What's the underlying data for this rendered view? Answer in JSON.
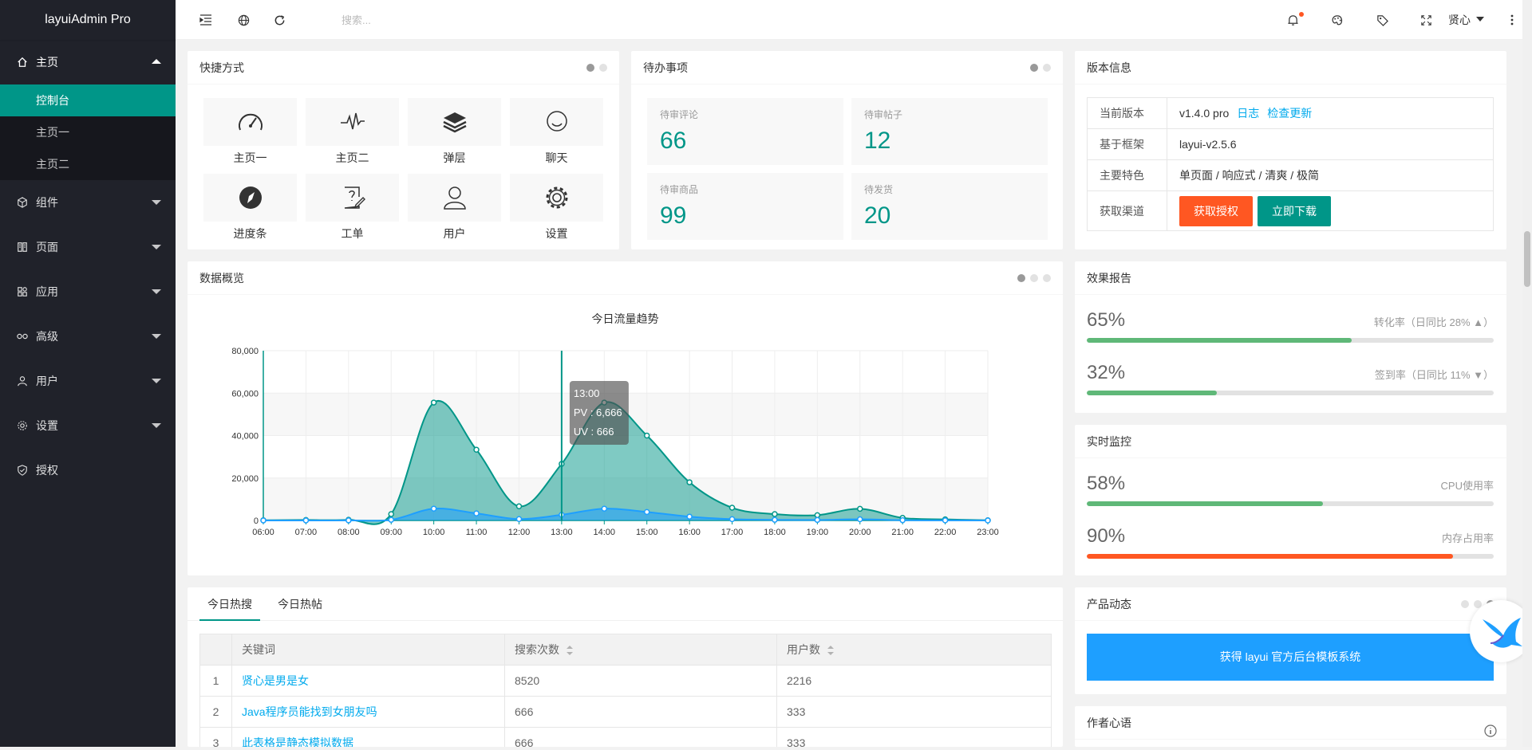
{
  "app": {
    "title": "layuiAdmin Pro"
  },
  "sidebar": {
    "items": [
      {
        "label": "主页",
        "icon": "home-icon",
        "open": true,
        "children": [
          "控制台",
          "主页一",
          "主页二"
        ]
      },
      {
        "label": "组件",
        "icon": "cube-icon"
      },
      {
        "label": "页面",
        "icon": "page-icon"
      },
      {
        "label": "应用",
        "icon": "app-icon"
      },
      {
        "label": "高级",
        "icon": "senior-icon"
      },
      {
        "label": "用户",
        "icon": "user-icon"
      },
      {
        "label": "设置",
        "icon": "gear-icon"
      },
      {
        "label": "授权",
        "icon": "shield-icon"
      }
    ]
  },
  "header": {
    "search_placeholder": "搜索...",
    "user": "贤心"
  },
  "shortcuts": {
    "title": "快捷方式",
    "items": [
      {
        "label": "主页一",
        "icon": "gauge-icon"
      },
      {
        "label": "主页二",
        "icon": "pulse-icon"
      },
      {
        "label": "弹层",
        "icon": "layers-icon"
      },
      {
        "label": "聊天",
        "icon": "chat-icon"
      },
      {
        "label": "进度条",
        "icon": "compass-icon"
      },
      {
        "label": "工单",
        "icon": "ticket-icon"
      },
      {
        "label": "用户",
        "icon": "user-icon"
      },
      {
        "label": "设置",
        "icon": "gear-icon"
      }
    ]
  },
  "todo": {
    "title": "待办事项",
    "items": [
      {
        "label": "待审评论",
        "value": "66"
      },
      {
        "label": "待审帖子",
        "value": "12"
      },
      {
        "label": "待审商品",
        "value": "99"
      },
      {
        "label": "待发货",
        "value": "20"
      }
    ]
  },
  "version": {
    "title": "版本信息",
    "rows": {
      "current_k": "当前版本",
      "current_v": "v1.4.0 pro",
      "log_link": "日志",
      "update_link": "检查更新",
      "framework_k": "基于框架",
      "framework_v": "layui-v2.5.6",
      "features_k": "主要特色",
      "features_v": "单页面 / 响应式 / 清爽 / 极简",
      "channel_k": "获取渠道",
      "btn_auth": "获取授权",
      "btn_download": "立即下载"
    }
  },
  "overview": {
    "title": "数据概览"
  },
  "report": {
    "title": "效果报告",
    "items": [
      {
        "value": "65%",
        "text": "转化率（日同比 28% ▲）",
        "fill": 0.65,
        "color": "#5fb878"
      },
      {
        "value": "32%",
        "text": "签到率（日同比 11% ▼）",
        "fill": 0.32,
        "color": "#5fb878"
      }
    ]
  },
  "monitor": {
    "title": "实时监控",
    "items": [
      {
        "value": "58%",
        "text": "CPU使用率",
        "fill": 0.58,
        "color": "#5fb878"
      },
      {
        "value": "90%",
        "text": "内存占用率",
        "fill": 0.9,
        "color": "#ff5722"
      }
    ]
  },
  "hot": {
    "tabs": [
      "今日热搜",
      "今日热帖"
    ],
    "headers": [
      "关键词",
      "搜索次数",
      "用户数"
    ],
    "rows": [
      {
        "n": "1",
        "kw": "贤心是男是女",
        "count": "8520",
        "users": "2216"
      },
      {
        "n": "2",
        "kw": "Java程序员能找到女朋友吗",
        "count": "666",
        "users": "333"
      },
      {
        "n": "3",
        "kw": "此表格是静态模拟数据",
        "count": "666",
        "users": "333"
      }
    ]
  },
  "product": {
    "title": "产品动态",
    "banner": "获得 layui 官方后台模板系统"
  },
  "author": {
    "title": "作者心语"
  },
  "chart_data": {
    "type": "area",
    "title": "今日流量趋势",
    "x": [
      "06:00",
      "07:00",
      "08:00",
      "09:00",
      "10:00",
      "11:00",
      "12:00",
      "13:00",
      "14:00",
      "15:00",
      "16:00",
      "17:00",
      "18:00",
      "19:00",
      "20:00",
      "21:00",
      "22:00",
      "23:00"
    ],
    "ylim": [
      0,
      80000
    ],
    "yticks": [
      "0",
      "20,000",
      "40,000",
      "60,000",
      "80,000"
    ],
    "series": [
      {
        "name": "PV",
        "color": "#009688",
        "values": [
          111,
          222,
          333,
          3000,
          55555,
          33333,
          6666,
          26666,
          55555,
          40000,
          18000,
          6000,
          3000,
          2500,
          5500,
          1200,
          500,
          100
        ]
      },
      {
        "name": "UV",
        "color": "#1e9fff",
        "values": [
          11,
          22,
          33,
          300,
          5555,
          3333,
          666,
          2666,
          5555,
          4000,
          1800,
          600,
          300,
          250,
          550,
          120,
          50,
          10
        ]
      }
    ],
    "tooltip": {
      "time": "13:00",
      "pv": "PV : 6,666",
      "uv": "UV : 666"
    }
  }
}
